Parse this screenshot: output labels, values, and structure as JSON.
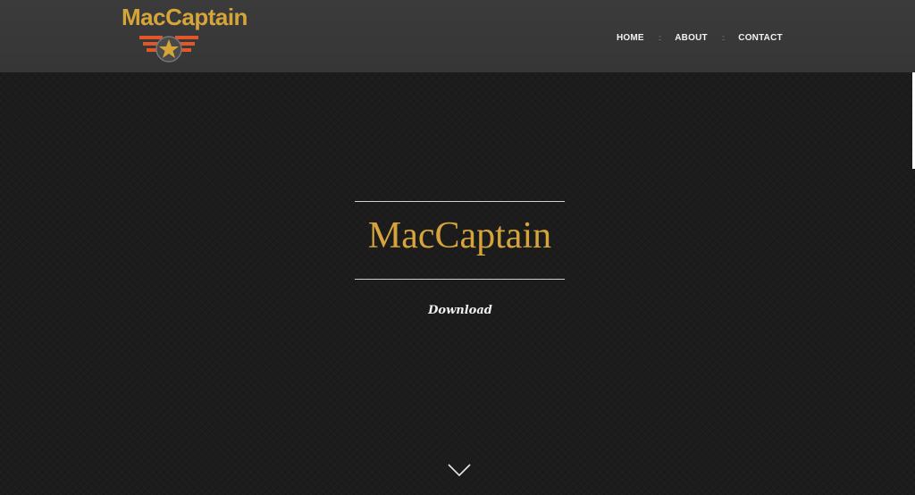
{
  "header": {
    "logo_text": "MacCaptain",
    "nav": [
      {
        "label": "HOME"
      },
      {
        "label": "ABOUT"
      },
      {
        "label": "CONTACT"
      }
    ],
    "separator": "::"
  },
  "hero": {
    "title": "MacCaptain",
    "download_label": "Download",
    "scroll_icon": "chevron-down-icon"
  },
  "colors": {
    "accent": "#d6a53a",
    "header_bg": "#3a3a3a",
    "page_bg": "#1c1c1c",
    "emblem_wing": "#e2572a"
  }
}
